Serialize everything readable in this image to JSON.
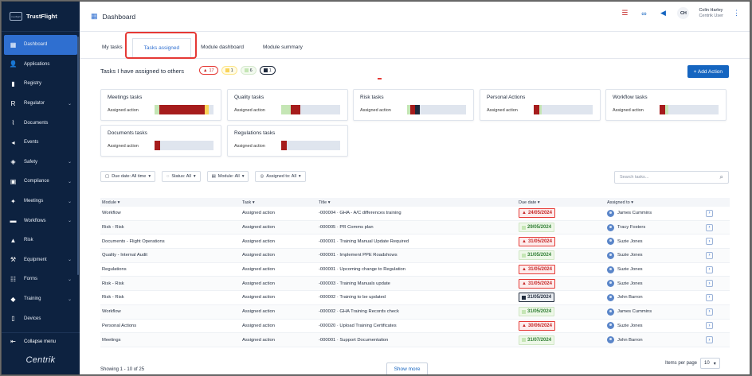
{
  "brand": {
    "name": "TrustFlight",
    "logo_text": "trustflight"
  },
  "sidebar": {
    "items": [
      {
        "label": "Dashboard",
        "icon": "dashboard-icon",
        "glyph": "▦",
        "chevron": false
      },
      {
        "label": "Applications",
        "icon": "user-icon",
        "glyph": "👤",
        "chevron": false
      },
      {
        "label": "Registry",
        "icon": "book-icon",
        "glyph": "▮",
        "chevron": false
      },
      {
        "label": "Regulator",
        "icon": "regulator-icon",
        "glyph": "R",
        "chevron": true
      },
      {
        "label": "Documents",
        "icon": "paperclip-icon",
        "glyph": "⌇",
        "chevron": false
      },
      {
        "label": "Events",
        "icon": "megaphone-icon",
        "glyph": "◂",
        "chevron": false
      },
      {
        "label": "Safety",
        "icon": "shield-icon",
        "glyph": "◈",
        "chevron": true
      },
      {
        "label": "Compliance",
        "icon": "compliance-icon",
        "glyph": "▣",
        "chevron": true
      },
      {
        "label": "Meetings",
        "icon": "meetings-icon",
        "glyph": "✦",
        "chevron": true
      },
      {
        "label": "Workflows",
        "icon": "workflow-icon",
        "glyph": "▬",
        "chevron": true
      },
      {
        "label": "Risk",
        "icon": "warning-icon",
        "glyph": "▲",
        "chevron": false
      },
      {
        "label": "Equipment",
        "icon": "wrench-icon",
        "glyph": "⚒",
        "chevron": true
      },
      {
        "label": "Forms",
        "icon": "forms-icon",
        "glyph": "☷",
        "chevron": true
      },
      {
        "label": "Training",
        "icon": "graduation-cap-icon",
        "glyph": "◆",
        "chevron": true
      },
      {
        "label": "Devices",
        "icon": "device-icon",
        "glyph": "▯",
        "chevron": false
      }
    ],
    "collapse_label": "Collapse menu",
    "footer_logo": "Centrik"
  },
  "header": {
    "title": "Dashboard",
    "user_initials": "CH",
    "user_name": "Colin Harley",
    "user_role": "Centrik User"
  },
  "tabs": [
    "My tasks",
    "Tasks assigned",
    "Module dashboard",
    "Module summary"
  ],
  "section": {
    "title": "Tasks I have assigned to others",
    "badges": {
      "overdue": "17",
      "due_soon": "1",
      "ok": "6",
      "no_date": "1"
    },
    "add_button": "+ Add Action"
  },
  "colors": {
    "overdue": "#a61c1c",
    "due_soon": "#f9d35a",
    "ok": "#c5e6b5",
    "no_date": "#1f2a3c",
    "accent": "#1565c0"
  },
  "cards": [
    {
      "title": "Meetings tasks",
      "sub": "Assigned action",
      "segments": [
        {
          "color": "ok",
          "fraction": 0.08
        },
        {
          "color": "overdue",
          "fraction": 0.77
        },
        {
          "color": "due_soon",
          "fraction": 0.07
        }
      ]
    },
    {
      "title": "Quality tasks",
      "sub": "Assigned action",
      "segments": [
        {
          "color": "ok",
          "fraction": 0.16
        },
        {
          "color": "overdue",
          "fraction": 0.16
        }
      ]
    },
    {
      "title": "Risk tasks",
      "sub": "Assigned action",
      "segments": [
        {
          "color": "ok",
          "fraction": 0.05
        },
        {
          "color": "overdue",
          "fraction": 0.09
        },
        {
          "color": "no_date",
          "fraction": 0.08
        }
      ]
    },
    {
      "title": "Personal Actions",
      "sub": "Assigned action",
      "segments": [
        {
          "color": "overdue",
          "fraction": 0.09
        },
        {
          "color": "ok",
          "fraction": 0.05
        }
      ]
    },
    {
      "title": "Workflow tasks",
      "sub": "Assigned action",
      "segments": [
        {
          "color": "overdue",
          "fraction": 0.09
        },
        {
          "color": "ok",
          "fraction": 0.06
        }
      ]
    },
    {
      "title": "Documents tasks",
      "sub": "Assigned action",
      "segments": [
        {
          "color": "overdue",
          "fraction": 0.09
        }
      ]
    },
    {
      "title": "Regulations tasks",
      "sub": "Assigned action",
      "segments": [
        {
          "color": "overdue",
          "fraction": 0.09
        }
      ]
    }
  ],
  "filters": [
    {
      "label": "Due date: All time",
      "icon": "calendar-icon",
      "glyph": "▢"
    },
    {
      "label": "Status: All",
      "icon": "status-icon",
      "glyph": "◌"
    },
    {
      "label": "Module: All",
      "icon": "module-icon",
      "glyph": "▤"
    },
    {
      "label": "Assigned to: All",
      "icon": "person-icon",
      "glyph": "◎"
    }
  ],
  "search": {
    "placeholder": "Search tasks..."
  },
  "table": {
    "headers": [
      "Module ▾",
      "Task ▾",
      "Title ▾",
      "Due date ▾",
      "Assigned to ▾"
    ],
    "rows": [
      {
        "module": "Workflow",
        "task": "Assigned action",
        "title": "-000004 · GHA - A/C differences training",
        "due": "24/05/2024",
        "status": "overdue",
        "assignee": "James Cummins"
      },
      {
        "module": "Risk - Risk",
        "task": "Assigned action",
        "title": "-000005 · PR Comms plan",
        "due": "29/05/2024",
        "status": "ok",
        "assignee": "Tracy Fosters"
      },
      {
        "module": "Documents - Flight Operations",
        "task": "Assigned action",
        "title": "-000001 · Training Manual Update Required",
        "due": "31/05/2024",
        "status": "overdue",
        "assignee": "Suzie Jones"
      },
      {
        "module": "Quality - Internal Audit",
        "task": "Assigned action",
        "title": "-000001 · Implement PPE Roadshows",
        "due": "31/05/2024",
        "status": "ok",
        "assignee": "Suzie Jones"
      },
      {
        "module": "Regulations",
        "task": "Assigned action",
        "title": "-000001 · Upcoming change to Regulation",
        "due": "31/05/2024",
        "status": "overdue",
        "assignee": "Suzie Jones"
      },
      {
        "module": "Risk - Risk",
        "task": "Assigned action",
        "title": "-000003 · Training Manuals update",
        "due": "31/05/2024",
        "status": "overdue",
        "assignee": "Suzie Jones"
      },
      {
        "module": "Risk - Risk",
        "task": "Assigned action",
        "title": "-000002 · Training to be updated",
        "due": "31/05/2024",
        "status": "dark",
        "assignee": "John Barron"
      },
      {
        "module": "Workflow",
        "task": "Assigned action",
        "title": "-000002 · GHA Training Records check",
        "due": "31/05/2024",
        "status": "ok",
        "assignee": "James Cummins"
      },
      {
        "module": "Personal Actions",
        "task": "Assigned action",
        "title": "-000020 · Upload Training Certificates",
        "due": "30/06/2024",
        "status": "overdue",
        "assignee": "Suzie Jones"
      },
      {
        "module": "Meetings",
        "task": "Assigned action",
        "title": "-000001 · Support Documentation",
        "due": "31/07/2024",
        "status": "ok",
        "assignee": "John Barron"
      }
    ]
  },
  "footer": {
    "showing": "Showing 1 - 10 of 25",
    "show_more": "Show more",
    "per_page_label": "Items per page",
    "per_page_value": "10"
  }
}
